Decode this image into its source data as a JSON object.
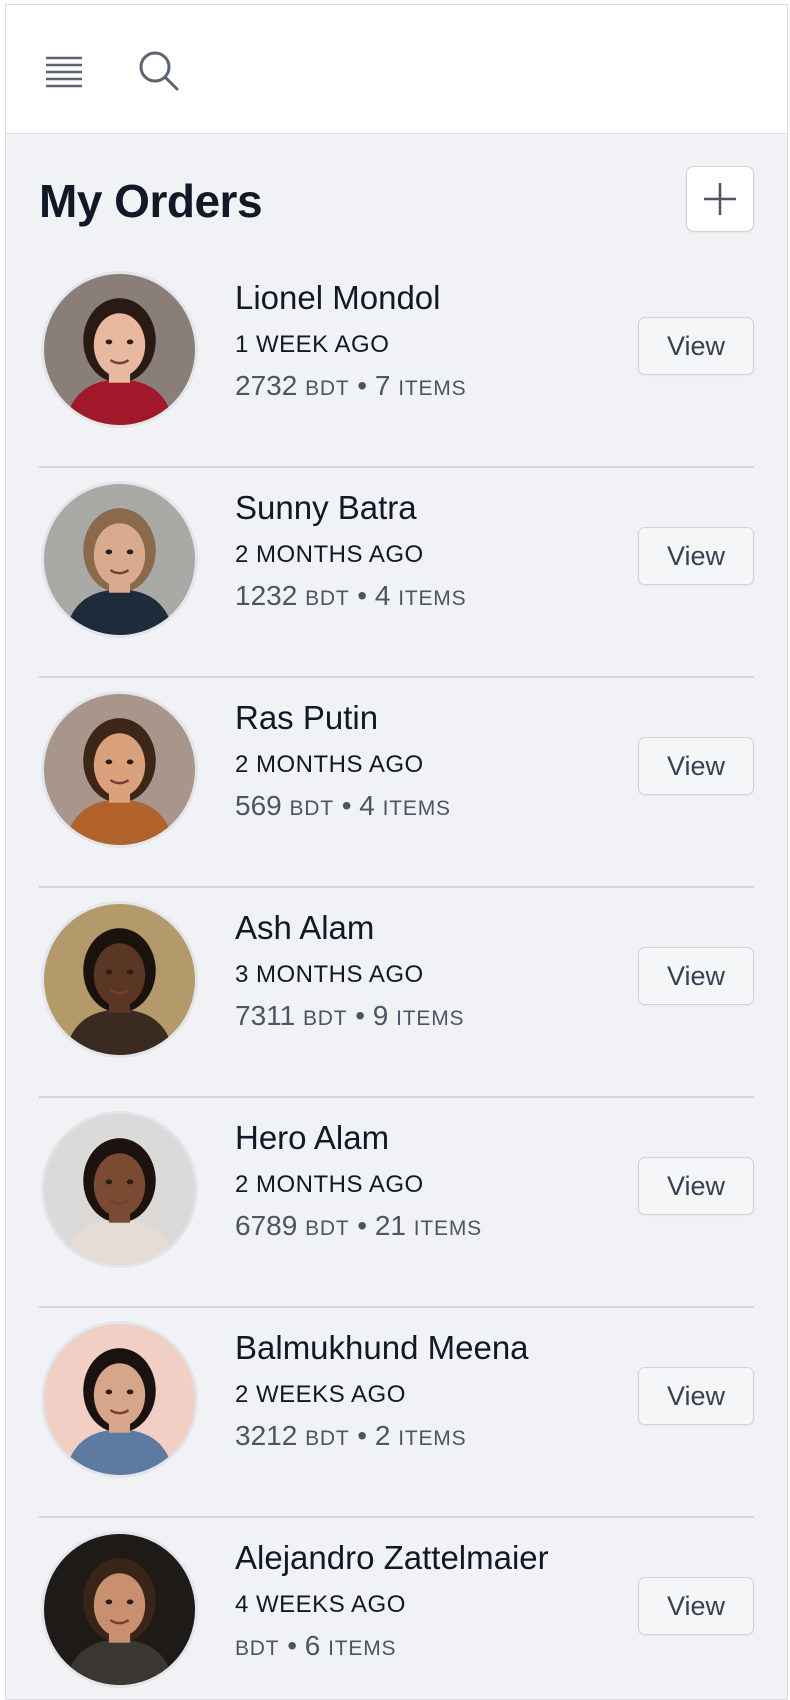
{
  "header": {
    "menu_icon": "hamburger-menu-icon",
    "search_icon": "search-icon"
  },
  "page": {
    "title": "My Orders",
    "add_icon": "plus-icon"
  },
  "colors": {
    "background": "#f0f2f5",
    "text": "#111827",
    "muted": "#4b5563",
    "divider": "#d3d7dd"
  },
  "orders": [
    {
      "name": "Lionel Mondol",
      "time": "1 WEEK AGO",
      "amount": "2732",
      "currency": "BDT",
      "separator": "•",
      "count": "7",
      "items_label": "ITEMS",
      "view_label": "View",
      "avatar": {
        "skin": "#e8b9a0",
        "hair": "#2a1a14",
        "shirt": "#a0182a",
        "bg": "#8a7f78"
      }
    },
    {
      "name": "Sunny Batra",
      "time": "2 MONTHS AGO",
      "amount": "1232",
      "currency": "BDT",
      "separator": "•",
      "count": "4",
      "items_label": "ITEMS",
      "view_label": "View",
      "avatar": {
        "skin": "#d9aa8e",
        "hair": "#8a6a4a",
        "shirt": "#1f2a3a",
        "bg": "#a9a9a6"
      }
    },
    {
      "name": "Ras Putin",
      "time": "2 MONTHS AGO",
      "amount": "569",
      "currency": "BDT",
      "separator": "•",
      "count": "4",
      "items_label": "ITEMS",
      "view_label": "View",
      "avatar": {
        "skin": "#d9a27d",
        "hair": "#3b2618",
        "shirt": "#b0622a",
        "bg": "#a8958c"
      }
    },
    {
      "name": "Ash Alam",
      "time": "3 MONTHS AGO",
      "amount": "7311",
      "currency": "BDT",
      "separator": "•",
      "count": "9",
      "items_label": "ITEMS",
      "view_label": "View",
      "avatar": {
        "skin": "#5a3624",
        "hair": "#1a120d",
        "shirt": "#3a2a20",
        "bg": "#b49a6a"
      }
    },
    {
      "name": "Hero Alam",
      "time": "2 MONTHS AGO",
      "amount": "6789",
      "currency": "BDT",
      "separator": "•",
      "count": "21",
      "items_label": "ITEMS",
      "view_label": "View",
      "avatar": {
        "skin": "#7a4a32",
        "hair": "#1c130f",
        "shirt": "#e6dcd6",
        "bg": "#dcdad8"
      }
    },
    {
      "name": "Balmukhund Meena",
      "time": "2 WEEKS AGO",
      "amount": "3212",
      "currency": "BDT",
      "separator": "•",
      "count": "2",
      "items_label": "ITEMS",
      "view_label": "View",
      "avatar": {
        "skin": "#d6a58a",
        "hair": "#1a1210",
        "shirt": "#5d7aa0",
        "bg": "#f1cfc4"
      }
    },
    {
      "name": "Alejandro Zattelmaier",
      "time": "4 WEEKS AGO",
      "amount": "",
      "currency": "BDT",
      "separator": "•",
      "count": "6",
      "items_label": "ITEMS",
      "view_label": "View",
      "avatar": {
        "skin": "#c8906e",
        "hair": "#3a2418",
        "shirt": "#3a3632",
        "bg": "#1e1a18"
      }
    }
  ]
}
